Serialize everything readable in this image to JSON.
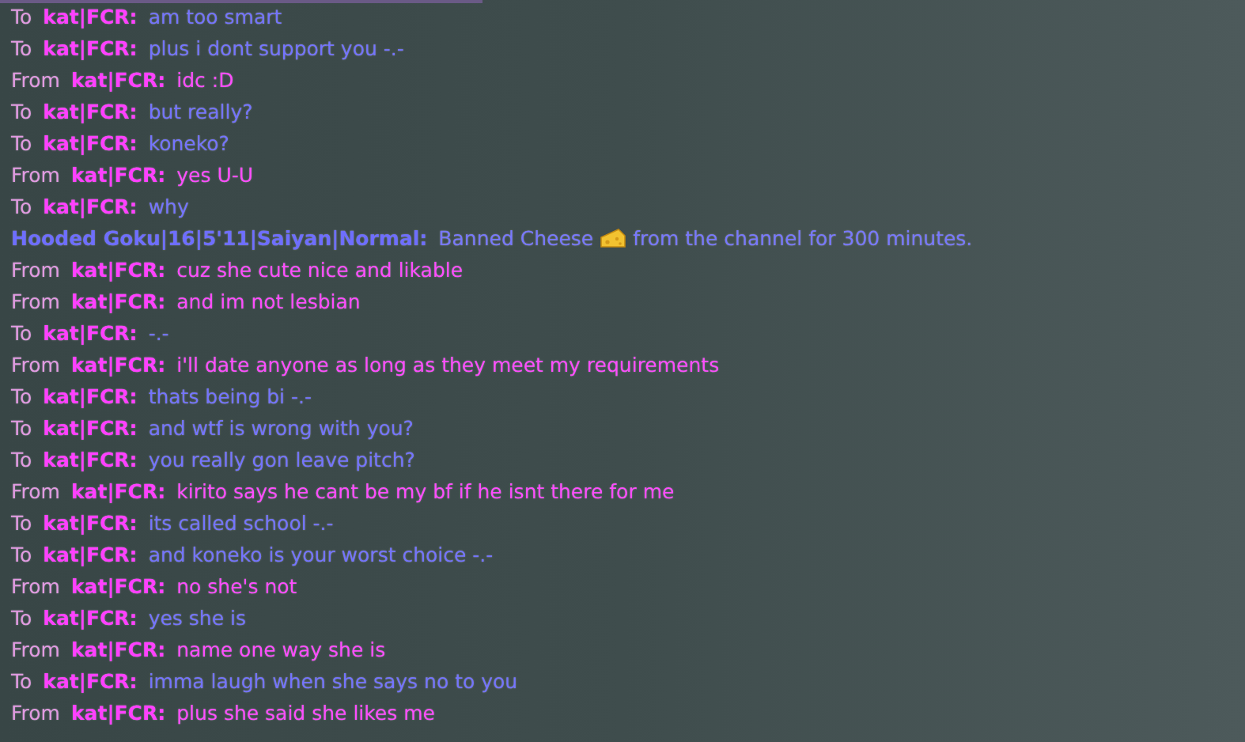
{
  "messages": [
    {
      "kind": "to",
      "direction": "To",
      "sender": "kat|FCR:",
      "text": "am too smart"
    },
    {
      "kind": "to",
      "direction": "To",
      "sender": "kat|FCR:",
      "text": "plus i dont support you -.-"
    },
    {
      "kind": "from",
      "direction": "From",
      "sender": "kat|FCR:",
      "text": "idc :D"
    },
    {
      "kind": "to",
      "direction": "To",
      "sender": "kat|FCR:",
      "text": "but really?"
    },
    {
      "kind": "to",
      "direction": "To",
      "sender": "kat|FCR:",
      "text": "koneko?"
    },
    {
      "kind": "from",
      "direction": "From",
      "sender": "kat|FCR:",
      "text": "yes U-U"
    },
    {
      "kind": "to",
      "direction": "To",
      "sender": "kat|FCR:",
      "text": "why"
    },
    {
      "kind": "system",
      "sender": "Hooded Goku|16|5'11|Saiyan|Normal:",
      "text": "Banned Cheese",
      "text_after": "from the channel for 300 minutes."
    },
    {
      "kind": "from",
      "direction": "From",
      "sender": "kat|FCR:",
      "text": "cuz she cute nice and likable"
    },
    {
      "kind": "from",
      "direction": "From",
      "sender": "kat|FCR:",
      "text": "and im not lesbian"
    },
    {
      "kind": "to",
      "direction": "To",
      "sender": "kat|FCR:",
      "text": "-.-"
    },
    {
      "kind": "from",
      "direction": "From",
      "sender": "kat|FCR:",
      "text": "i'll date anyone as long as they meet my requirements"
    },
    {
      "kind": "to",
      "direction": "To",
      "sender": "kat|FCR:",
      "text": "thats being bi -.-"
    },
    {
      "kind": "to",
      "direction": "To",
      "sender": "kat|FCR:",
      "text": "and wtf is wrong with you?"
    },
    {
      "kind": "to",
      "direction": "To",
      "sender": "kat|FCR:",
      "text": "you really gon leave pitch?"
    },
    {
      "kind": "from",
      "direction": "From",
      "sender": "kat|FCR:",
      "text": "kirito says he cant be my bf if he isnt there for me"
    },
    {
      "kind": "to",
      "direction": "To",
      "sender": "kat|FCR:",
      "text": "its called school -.-"
    },
    {
      "kind": "to",
      "direction": "To",
      "sender": "kat|FCR:",
      "text": "and koneko is your worst choice -.-"
    },
    {
      "kind": "from",
      "direction": "From",
      "sender": "kat|FCR:",
      "text": "no she's not"
    },
    {
      "kind": "to",
      "direction": "To",
      "sender": "kat|FCR:",
      "text": "yes she is"
    },
    {
      "kind": "from",
      "direction": "From",
      "sender": "kat|FCR:",
      "text": "name one way she is"
    },
    {
      "kind": "to",
      "direction": "To",
      "sender": "kat|FCR:",
      "text": "imma laugh when she says no to you"
    },
    {
      "kind": "from",
      "direction": "From",
      "sender": "kat|FCR:",
      "text": "plus she said she likes me"
    }
  ]
}
